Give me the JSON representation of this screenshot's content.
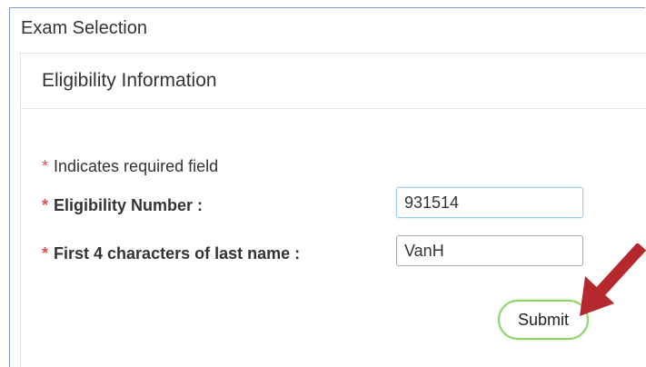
{
  "window": {
    "title": "Exam Selection"
  },
  "panel": {
    "title": "Eligibility Information"
  },
  "form": {
    "required_marker": "*",
    "required_note": "Indicates required field",
    "eligibility": {
      "label": "Eligibility Number :",
      "value": "931514"
    },
    "last_name": {
      "label": "First 4 characters of last name :",
      "value": "VanH"
    },
    "submit_label": "Submit"
  },
  "colors": {
    "required_asterisk": "#d9534f",
    "submit_border": "#8fd16b",
    "annotation_arrow": "#b5282e",
    "frame_border": "#7d9cc7"
  },
  "icons": {
    "annotation": "arrow-pointing-to-submit-icon"
  }
}
